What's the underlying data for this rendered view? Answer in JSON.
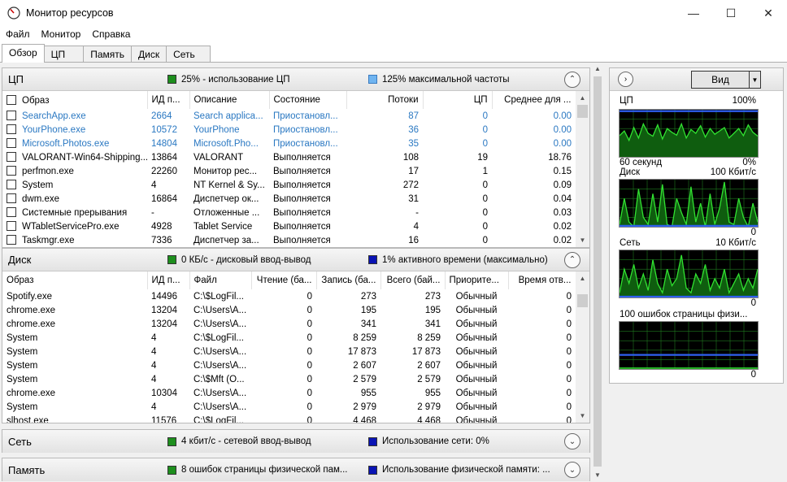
{
  "window": {
    "title": "Монитор ресурсов"
  },
  "menu": [
    "Файл",
    "Монитор",
    "Справка"
  ],
  "tabs": [
    "Обзор",
    "ЦП",
    "Память",
    "Диск",
    "Сеть"
  ],
  "colors": {
    "green": "#1e8f1e",
    "light_blue": "#6fb4f0",
    "dark_blue": "#0a14b4",
    "suspended_text": "#2a78c2"
  },
  "cpu": {
    "title": "ЦП",
    "stat1": "25% - использование ЦП",
    "stat2": "125% максимальной частоты",
    "columns": [
      "Образ",
      "ИД п...",
      "Описание",
      "Состояние",
      "Потоки",
      "ЦП",
      "Среднее для ..."
    ],
    "rows": [
      {
        "name": "SearchApp.exe",
        "pid": "2664",
        "desc": "Search applica...",
        "state": "Приостановл...",
        "threads": "87",
        "cpu": "0",
        "avg": "0.00",
        "suspended": true
      },
      {
        "name": "YourPhone.exe",
        "pid": "10572",
        "desc": "YourPhone",
        "state": "Приостановл...",
        "threads": "36",
        "cpu": "0",
        "avg": "0.00",
        "suspended": true
      },
      {
        "name": "Microsoft.Photos.exe",
        "pid": "14804",
        "desc": "Microsoft.Pho...",
        "state": "Приостановл...",
        "threads": "35",
        "cpu": "0",
        "avg": "0.00",
        "suspended": true
      },
      {
        "name": "VALORANT-Win64-Shipping....",
        "pid": "13864",
        "desc": "VALORANT",
        "state": "Выполняется",
        "threads": "108",
        "cpu": "19",
        "avg": "18.76",
        "suspended": false
      },
      {
        "name": "perfmon.exe",
        "pid": "22260",
        "desc": "Монитор рес...",
        "state": "Выполняется",
        "threads": "17",
        "cpu": "1",
        "avg": "0.15",
        "suspended": false
      },
      {
        "name": "System",
        "pid": "4",
        "desc": "NT Kernel & Sy...",
        "state": "Выполняется",
        "threads": "272",
        "cpu": "0",
        "avg": "0.09",
        "suspended": false
      },
      {
        "name": "dwm.exe",
        "pid": "16864",
        "desc": "Диспетчер ок...",
        "state": "Выполняется",
        "threads": "31",
        "cpu": "0",
        "avg": "0.04",
        "suspended": false
      },
      {
        "name": "Системные прерывания",
        "pid": "-",
        "desc": "Отложенные ...",
        "state": "Выполняется",
        "threads": "-",
        "cpu": "0",
        "avg": "0.03",
        "suspended": false
      },
      {
        "name": "WTabletServicePro.exe",
        "pid": "4928",
        "desc": "Tablet Service",
        "state": "Выполняется",
        "threads": "4",
        "cpu": "0",
        "avg": "0.02",
        "suspended": false
      },
      {
        "name": "Taskmgr.exe",
        "pid": "7336",
        "desc": "Диспетчер за...",
        "state": "Выполняется",
        "threads": "16",
        "cpu": "0",
        "avg": "0.02",
        "suspended": false
      }
    ]
  },
  "disk": {
    "title": "Диск",
    "stat1": "0 КБ/с - дисковый ввод-вывод",
    "stat2": "1% активного времени (максимально)",
    "columns": [
      "Образ",
      "ИД п...",
      "Файл",
      "Чтение (ба...",
      "Запись (ба...",
      "Всего (бай...",
      "Приорите...",
      "Время отв..."
    ],
    "rows": [
      {
        "name": "Spotify.exe",
        "pid": "14496",
        "file": "C:\\$LogFil...",
        "read": "0",
        "write": "273",
        "total": "273",
        "prio": "Обычный",
        "resp": "0"
      },
      {
        "name": "chrome.exe",
        "pid": "13204",
        "file": "C:\\Users\\A...",
        "read": "0",
        "write": "195",
        "total": "195",
        "prio": "Обычный",
        "resp": "0"
      },
      {
        "name": "chrome.exe",
        "pid": "13204",
        "file": "C:\\Users\\A...",
        "read": "0",
        "write": "341",
        "total": "341",
        "prio": "Обычный",
        "resp": "0"
      },
      {
        "name": "System",
        "pid": "4",
        "file": "C:\\$LogFil...",
        "read": "0",
        "write": "8 259",
        "total": "8 259",
        "prio": "Обычный",
        "resp": "0"
      },
      {
        "name": "System",
        "pid": "4",
        "file": "C:\\Users\\A...",
        "read": "0",
        "write": "17 873",
        "total": "17 873",
        "prio": "Обычный",
        "resp": "0"
      },
      {
        "name": "System",
        "pid": "4",
        "file": "C:\\Users\\A...",
        "read": "0",
        "write": "2 607",
        "total": "2 607",
        "prio": "Обычный",
        "resp": "0"
      },
      {
        "name": "System",
        "pid": "4",
        "file": "C:\\$Mft (O...",
        "read": "0",
        "write": "2 579",
        "total": "2 579",
        "prio": "Обычный",
        "resp": "0"
      },
      {
        "name": "chrome.exe",
        "pid": "10304",
        "file": "C:\\Users\\A...",
        "read": "0",
        "write": "955",
        "total": "955",
        "prio": "Обычный",
        "resp": "0"
      },
      {
        "name": "System",
        "pid": "4",
        "file": "C:\\Users\\A...",
        "read": "0",
        "write": "2 979",
        "total": "2 979",
        "prio": "Обычный",
        "resp": "0"
      },
      {
        "name": "slhost.exe",
        "pid": "11576",
        "file": "C:\\$LogFil...",
        "read": "0",
        "write": "4 468",
        "total": "4 468",
        "prio": "Обычный",
        "resp": "0"
      }
    ]
  },
  "network": {
    "title": "Сеть",
    "stat1": "4 кбит/с - сетевой ввод-вывод",
    "stat2": "Использование сети: 0%"
  },
  "memory": {
    "title": "Память",
    "stat1": "8 ошибок страницы физической пам...",
    "stat2": "Использование физической памяти: ..."
  },
  "right_panel": {
    "view_label": "Вид",
    "graphs": [
      {
        "name": "ЦП",
        "max": "100%",
        "bottom_left": "60 секунд",
        "bottom_right": "0%",
        "blue_level": 0.97,
        "series": [
          0.45,
          0.55,
          0.35,
          0.62,
          0.4,
          0.7,
          0.5,
          0.44,
          0.68,
          0.38,
          0.6,
          0.52,
          0.46,
          0.7,
          0.4,
          0.58,
          0.5,
          0.66,
          0.42,
          0.6,
          0.48,
          0.55,
          0.62,
          0.4,
          0.5,
          0.6,
          0.45,
          0.68,
          0.52,
          0.44
        ]
      },
      {
        "name": "Диск",
        "max": "100 Кбит/с",
        "bottom_left": "",
        "bottom_right": "0",
        "blue_level": 0.02,
        "series": [
          0.05,
          0.6,
          0.1,
          0.0,
          0.8,
          0.2,
          0.05,
          0.7,
          0.1,
          0.9,
          0.05,
          0.0,
          0.6,
          0.3,
          0.05,
          0.85,
          0.1,
          0.5,
          0.0,
          0.7,
          0.05,
          0.4,
          0.95,
          0.1,
          0.05,
          0.6,
          0.2,
          0.0,
          0.5,
          0.1
        ]
      },
      {
        "name": "Сеть",
        "max": "10 Кбит/с",
        "bottom_left": "",
        "bottom_right": "0",
        "blue_level": 0.0,
        "series": [
          0.1,
          0.6,
          0.3,
          0.7,
          0.2,
          0.5,
          0.15,
          0.8,
          0.3,
          0.1,
          0.6,
          0.25,
          0.4,
          0.9,
          0.2,
          0.1,
          0.5,
          0.3,
          0.7,
          0.15,
          0.4,
          0.2,
          0.6,
          0.1,
          0.3,
          0.5,
          0.15,
          0.4,
          0.2,
          0.6
        ]
      },
      {
        "name": "100 ошибок страницы физи...",
        "max": "",
        "bottom_left": "",
        "bottom_right": "0",
        "blue_level": 0.3,
        "series": [
          0.02,
          0.02,
          0.02,
          0.02,
          0.02,
          0.02,
          0.02,
          0.02,
          0.02,
          0.02,
          0.02,
          0.02,
          0.02,
          0.02,
          0.02,
          0.02,
          0.02,
          0.02,
          0.02,
          0.02,
          0.02,
          0.02,
          0.02,
          0.02,
          0.02,
          0.02,
          0.02,
          0.02,
          0.02,
          0.02
        ]
      }
    ]
  }
}
